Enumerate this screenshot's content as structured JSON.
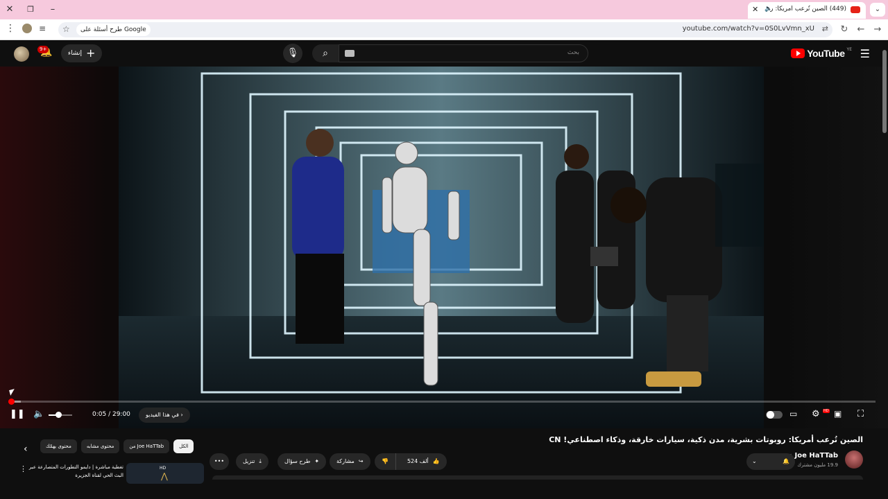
{
  "browser": {
    "tab_title": "(449) الصين تُرعب أمريكا: رو",
    "tab_audio_icon": "audio-icon",
    "url": "youtube.com/watch?v=0S0LvVmn_xU",
    "google_chip": "طرح أسئلة على Google",
    "window_controls": [
      "close-icon",
      "restore-icon",
      "minimize-icon"
    ]
  },
  "youtube_header": {
    "logo_text": "YouTube",
    "logo_country": "YE",
    "search_placeholder": "بحث",
    "create_label": "إنشاء",
    "notifications_badge": "9+"
  },
  "player": {
    "time": "0:05 / 29:00",
    "chapter_label": "في هذا الفيديو",
    "progress_fraction": 0.003,
    "buffer_fraction": 0.014,
    "volume_fraction": 0.4,
    "hd_badge": "HD"
  },
  "video": {
    "title": "الصين تُرعب أمريكا: روبوتات بشرية، مدن ذكية، سيارات خارقة، وذكاء اصطناعي! CN",
    "channel_name": "Joe HaTTab",
    "subscribers": "19.9 مليون مشترك",
    "likes": "524 ألف",
    "share_label": "مشاركة",
    "ask_label": "طرح سؤال",
    "download_label": "تنزيل"
  },
  "related": {
    "chips": [
      {
        "label": "الكل",
        "active": true
      },
      {
        "label": "من Joe HaTTab",
        "active": false
      },
      {
        "label": "محتوى مشابه",
        "active": false
      },
      {
        "label": "محتوى يهمّك",
        "active": false
      }
    ],
    "rec_title": "تغطية مباشرة | دايمو التطورات المتصارعة عبر البث الحي لقناة الجزيرة",
    "rec_thumb_label": "HD"
  }
}
